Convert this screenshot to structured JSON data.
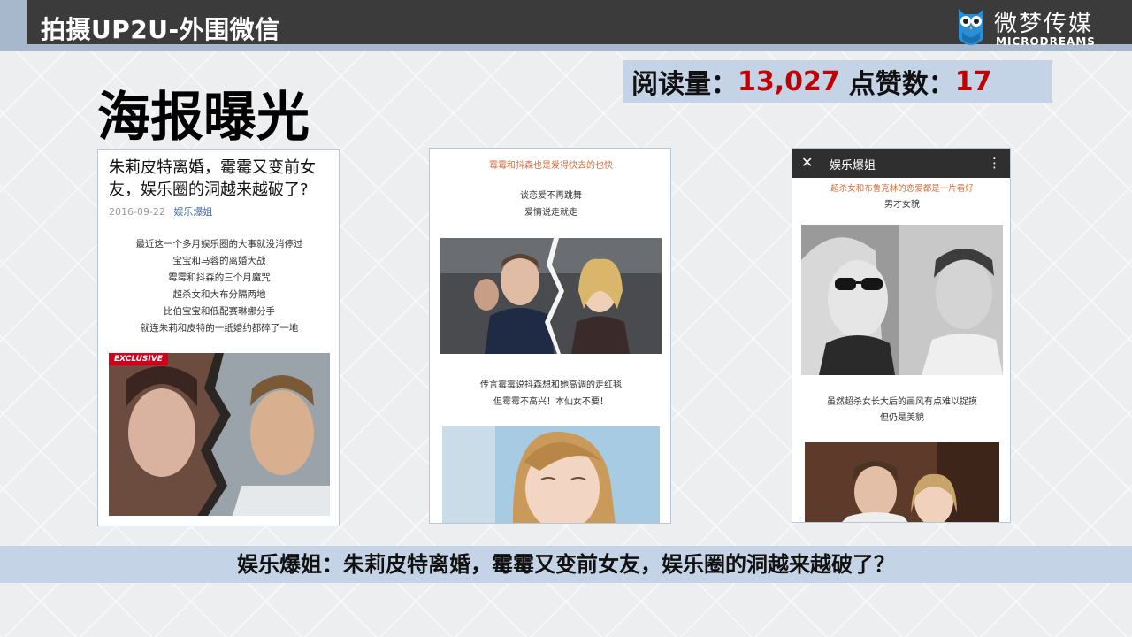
{
  "header": {
    "title": "拍摄UP2U-外围微信",
    "logo": {
      "name_cn": "微梦传媒",
      "name_en": "MICRODREAMS",
      "icon": "owl-logo-icon"
    }
  },
  "stats": {
    "reads_label": "阅读量：",
    "reads_value": "13,027",
    "likes_label": "点赞数：",
    "likes_value": "17"
  },
  "heading": "海报曝光",
  "panels": [
    {
      "title": "朱莉皮特离婚，霉霉又变前女友，娱乐圈的洞越来越破了?",
      "date": "2016-09-22",
      "author": "娱乐爆姐",
      "lines": [
        "最近这一个多月娱乐圈的大事就没消停过",
        "宝宝和马蓉的离婚大战",
        "霉霉和抖森的三个月魔咒",
        "超杀女和大布分隔两地",
        "比伯宝宝和低配赛琳娜分手",
        "就连朱莉和皮特的一纸婚约都碎了一地"
      ],
      "badge": "EXCLUSIVE"
    },
    {
      "heading": "霉霉和抖森也是爱得快去的也快",
      "lines1": [
        "谈恋爱不再跳舞",
        "爱情说走就走"
      ],
      "lines2": [
        "传言霉霉说抖森想和她高调的走红毯",
        "但霉霉不高兴！本仙女不要！"
      ]
    },
    {
      "bar_title": "娱乐爆姐",
      "close_glyph": "✕",
      "more_glyph": "⋮",
      "heading": "超杀女和布鲁克林的恋爱都是一片看好",
      "sub": "男才女貌",
      "lines": [
        "虽然超杀女长大后的画风有点难以捉摸",
        "但仍是美貌"
      ]
    }
  ],
  "caption": "娱乐爆姐：朱莉皮特离婚，霉霉又变前女友，娱乐圈的洞越来越破了？",
  "colors": {
    "header_bg": "#3b3b3b",
    "accent": "#a8b8cc",
    "highlight": "#c00000",
    "band": "#c5d3e6"
  }
}
